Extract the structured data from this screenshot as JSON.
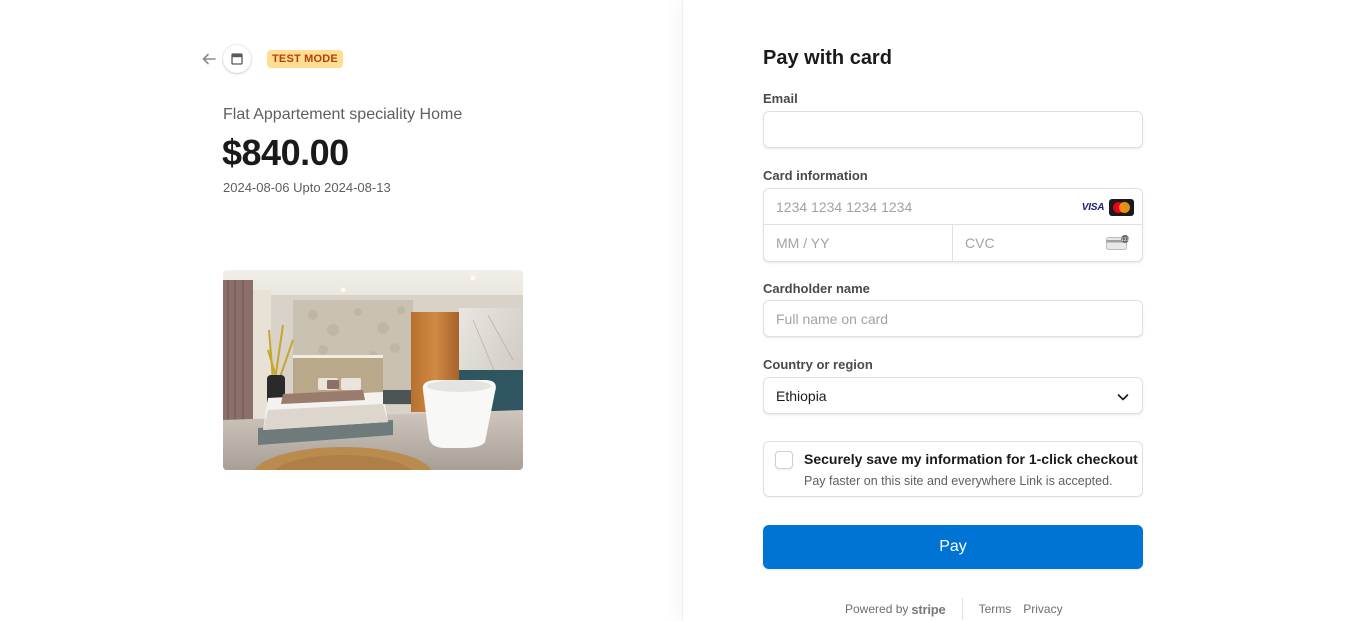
{
  "header": {
    "back_icon": "arrow-left-icon",
    "store_icon": "storefront-icon",
    "badge": "TEST MODE"
  },
  "product": {
    "name": "Flat Appartement speciality Home",
    "price": "$840.00",
    "dates": "2024-08-06 Upto 2024-08-13",
    "image": "bedroom-photo"
  },
  "form": {
    "title": "Pay with card",
    "email": {
      "label": "Email",
      "value": ""
    },
    "card": {
      "label": "Card information",
      "number_placeholder": "1234 1234 1234 1234",
      "expiry_placeholder": "MM / YY",
      "cvc_placeholder": "CVC",
      "brands": [
        "VISA",
        "mastercard"
      ]
    },
    "cardholder": {
      "label": "Cardholder name",
      "placeholder": "Full name on card"
    },
    "country": {
      "label": "Country or region",
      "value": "Ethiopia"
    },
    "save_info": {
      "title": "Securely save my information for 1-click checkout",
      "subtitle": "Pay faster on this site and everywhere Link is accepted.",
      "checked": false
    },
    "pay_label": "Pay"
  },
  "footer": {
    "powered_by": "Powered by",
    "brand": "stripe",
    "terms": "Terms",
    "privacy": "Privacy"
  },
  "colors": {
    "accent": "#0074d4",
    "badge_bg": "#ffde92",
    "badge_text": "#b3400a"
  }
}
